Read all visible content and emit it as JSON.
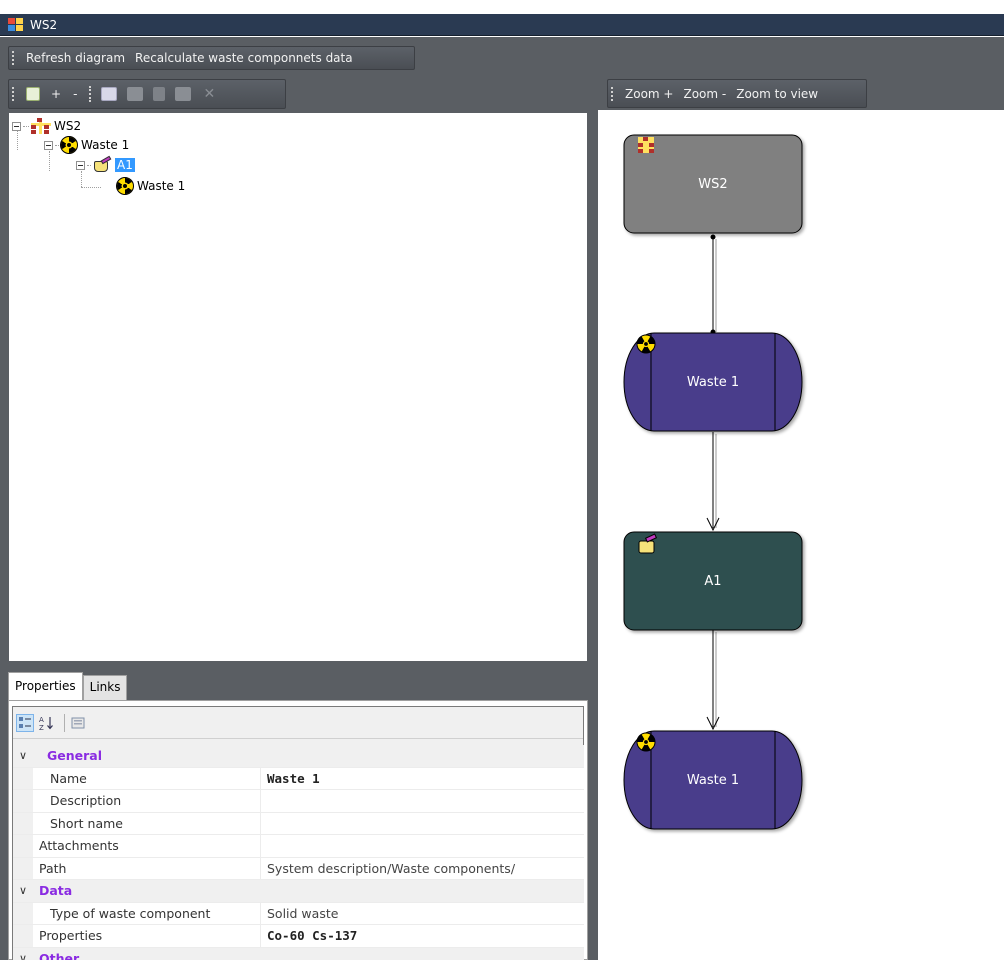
{
  "window": {
    "title": "WS2"
  },
  "menu": {
    "refresh": "Refresh diagram",
    "recalculate": "Recalculate waste componnets data"
  },
  "tree_toolbar": {
    "add": "+",
    "remove": "-"
  },
  "tree": {
    "nodes": [
      {
        "label": "WS2",
        "icon": "system-icon",
        "selected": false
      },
      {
        "label": "Waste 1",
        "icon": "radioactive-icon",
        "selected": false
      },
      {
        "label": "A1",
        "icon": "storage-drum-icon",
        "selected": true
      },
      {
        "label": "Waste 1",
        "icon": "radioactive-icon",
        "selected": false
      }
    ]
  },
  "diagram_toolbar": {
    "zoom_in": "Zoom +",
    "zoom_out": "Zoom -",
    "zoom_view": "Zoom to view"
  },
  "diagram": {
    "nodes": [
      {
        "label": "WS2",
        "color": "#808080",
        "icon": "system-icon"
      },
      {
        "label": "Waste 1",
        "color": "#483d8b",
        "icon": "radioactive-icon"
      },
      {
        "label": "A1",
        "color": "#2f4f4f",
        "icon": "storage-drum-icon"
      },
      {
        "label": "Waste 1",
        "color": "#483d8b",
        "icon": "radioactive-icon"
      }
    ]
  },
  "properties": {
    "tabs": [
      "Properties",
      "Links"
    ],
    "toolbar_icons": [
      "categorized-icon",
      "alphabetical-icon",
      "property-pages-icon"
    ],
    "categories": [
      {
        "name": "General",
        "rows": [
          {
            "name": "Name",
            "value": "Waste 1",
            "bold": true,
            "indent": true
          },
          {
            "name": "Description",
            "value": "",
            "bold": false,
            "indent": true
          },
          {
            "name": "Short name",
            "value": "",
            "bold": false,
            "indent": true
          },
          {
            "name": "Attachments",
            "value": "",
            "bold": false,
            "indent": false
          },
          {
            "name": "Path",
            "value": "System description/Waste components/",
            "bold": false,
            "indent": false
          }
        ]
      },
      {
        "name": "Data",
        "rows": [
          {
            "name": "Type of waste component",
            "value": "Solid waste",
            "bold": false,
            "indent": true
          },
          {
            "name": "Properties",
            "value": "Co-60 Cs-137",
            "bold": true,
            "indent": false
          }
        ]
      },
      {
        "name": "Other",
        "rows": []
      }
    ]
  }
}
